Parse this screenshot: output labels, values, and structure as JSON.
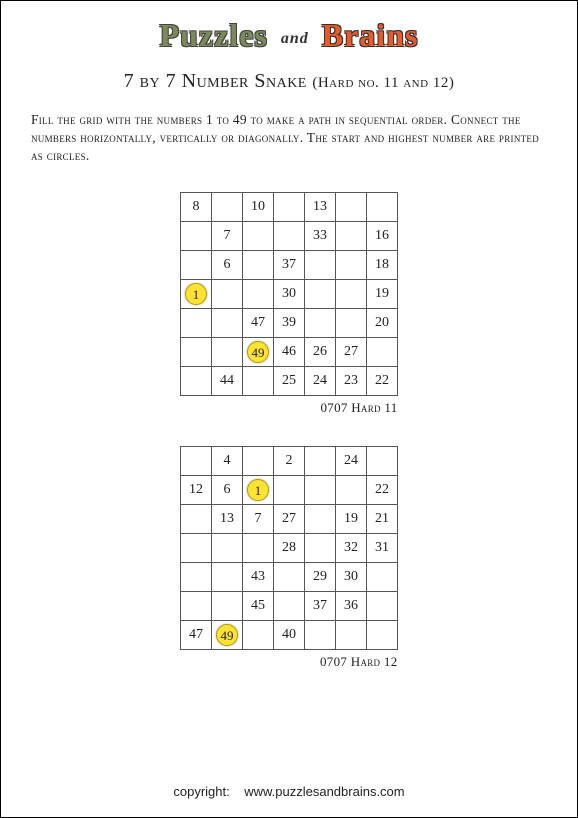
{
  "logo": {
    "word1": "Puzzles",
    "joiner": "and",
    "word2": "Brains"
  },
  "title": {
    "main": "7 by 7 Number Snake",
    "paren": "(Hard no. 11 and 12)"
  },
  "instructions": "Fill the grid with the numbers 1 to 49 to make a path in sequential order. Connect the numbers horizontally, vertically or diagonally. The start and highest number are printed as circles.",
  "puzzles": [
    {
      "caption": "0707 Hard 11",
      "grid": [
        [
          {
            "v": "8"
          },
          {
            "v": ""
          },
          {
            "v": "10"
          },
          {
            "v": ""
          },
          {
            "v": "13"
          },
          {
            "v": ""
          },
          {
            "v": ""
          }
        ],
        [
          {
            "v": ""
          },
          {
            "v": "7"
          },
          {
            "v": ""
          },
          {
            "v": ""
          },
          {
            "v": "33"
          },
          {
            "v": ""
          },
          {
            "v": "16"
          }
        ],
        [
          {
            "v": ""
          },
          {
            "v": "6"
          },
          {
            "v": ""
          },
          {
            "v": "37"
          },
          {
            "v": ""
          },
          {
            "v": ""
          },
          {
            "v": "18"
          }
        ],
        [
          {
            "v": "1",
            "c": true
          },
          {
            "v": ""
          },
          {
            "v": ""
          },
          {
            "v": "30"
          },
          {
            "v": ""
          },
          {
            "v": ""
          },
          {
            "v": "19"
          }
        ],
        [
          {
            "v": ""
          },
          {
            "v": ""
          },
          {
            "v": "47"
          },
          {
            "v": "39"
          },
          {
            "v": ""
          },
          {
            "v": ""
          },
          {
            "v": "20"
          }
        ],
        [
          {
            "v": ""
          },
          {
            "v": ""
          },
          {
            "v": "49",
            "c": true
          },
          {
            "v": "46"
          },
          {
            "v": "26"
          },
          {
            "v": "27"
          },
          {
            "v": ""
          }
        ],
        [
          {
            "v": ""
          },
          {
            "v": "44"
          },
          {
            "v": ""
          },
          {
            "v": "25"
          },
          {
            "v": "24"
          },
          {
            "v": "23"
          },
          {
            "v": "22"
          }
        ]
      ]
    },
    {
      "caption": "0707 Hard 12",
      "grid": [
        [
          {
            "v": ""
          },
          {
            "v": "4"
          },
          {
            "v": ""
          },
          {
            "v": "2"
          },
          {
            "v": ""
          },
          {
            "v": "24"
          },
          {
            "v": ""
          }
        ],
        [
          {
            "v": "12"
          },
          {
            "v": "6"
          },
          {
            "v": "1",
            "c": true
          },
          {
            "v": ""
          },
          {
            "v": ""
          },
          {
            "v": ""
          },
          {
            "v": "22"
          }
        ],
        [
          {
            "v": ""
          },
          {
            "v": "13"
          },
          {
            "v": "7"
          },
          {
            "v": "27"
          },
          {
            "v": ""
          },
          {
            "v": "19"
          },
          {
            "v": "21"
          }
        ],
        [
          {
            "v": ""
          },
          {
            "v": ""
          },
          {
            "v": ""
          },
          {
            "v": "28"
          },
          {
            "v": ""
          },
          {
            "v": "32"
          },
          {
            "v": "31"
          }
        ],
        [
          {
            "v": ""
          },
          {
            "v": ""
          },
          {
            "v": "43"
          },
          {
            "v": ""
          },
          {
            "v": "29"
          },
          {
            "v": "30"
          },
          {
            "v": ""
          }
        ],
        [
          {
            "v": ""
          },
          {
            "v": ""
          },
          {
            "v": "45"
          },
          {
            "v": ""
          },
          {
            "v": "37"
          },
          {
            "v": "36"
          },
          {
            "v": ""
          }
        ],
        [
          {
            "v": "47"
          },
          {
            "v": "49",
            "c": true
          },
          {
            "v": ""
          },
          {
            "v": "40"
          },
          {
            "v": ""
          },
          {
            "v": ""
          },
          {
            "v": ""
          }
        ]
      ]
    }
  ],
  "footer": {
    "label": "copyright:",
    "url": "www.puzzlesandbrains.com"
  }
}
